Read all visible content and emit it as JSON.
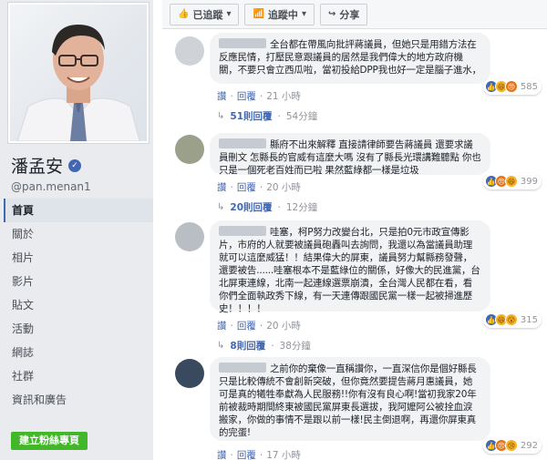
{
  "sidebar": {
    "name": "潘孟安",
    "username": "@pan.menan1",
    "nav": [
      "首頁",
      "關於",
      "相片",
      "影片",
      "貼文",
      "活動",
      "網誌",
      "社群",
      "資訊和廣告"
    ],
    "create_button": "建立粉絲專頁"
  },
  "action_bar": {
    "following": "已追蹤",
    "followed": "追蹤中",
    "share": "分享"
  },
  "comments": [
    {
      "text": "全台都在帶風向批評蔣議員，但她只是用錯方法在反應民情，打壓民意跟議員的居然是我們偉大的地方政府機關，不要只會立西瓜啦，當初投給DPP我也好一定是腦子進水，",
      "reply_label": "讚",
      "reply": "回覆",
      "time": "21 小時",
      "reaction_count": "585",
      "replies_label": "51則回覆",
      "replies_time": "54分鐘"
    },
    {
      "text": "縣府不出來解釋 直接請律師要告蔣議員 還要求議員刪文 怎縣長的官威有這麼大嗎 沒有了縣長光環講難聽點 你也只是一個死老百姓而已啦 果然藍綠都一樣是垃圾",
      "reply_label": "讚",
      "reply": "回覆",
      "time": "20 小時",
      "reaction_count": "399",
      "replies_label": "20則回覆",
      "replies_time": "12分鐘"
    },
    {
      "text": "哇塞，柯P努力改變台北，只是拍0元市政宣傳影片，市府的人就要被議員砲轟叫去詢問，我還以為當議員助理就可以這麼威猛！！結果偉大的屏東，議員努力幫縣務發聲，還要被告......哇塞根本不是藍綠位的關係，好像大的民進黨，台北屏東連線，北南一起連線選票崩潰，全台灣人民都在看，看你們全面執政秀下線，有一天連傳跟國民黨一樣一起被掃進歷史！！！！",
      "reply_label": "讚",
      "reply": "回覆",
      "time": "20 小時",
      "reaction_count": "315",
      "replies_label": "8則回覆",
      "replies_time": "38分鐘"
    },
    {
      "text": "之前你的棄像一直稱讚你，一直深信你是個好縣長只是比較傳統不會創新突破，但你竟然要提告蔣月惠議員，她可是真的犧牲奉獻為人民服務!!你有沒有良心啊!當初我家20年前被裁時期間終東被國民黨屏東長選拔，我阿嬤阿公被拴血淚搬家，你做的事情不是跟以前一樣!民主倒退啊，再還你屏東真的完蛋!",
      "reply_label": "讚",
      "reply": "回覆",
      "time": "17 小時",
      "reaction_count": "292"
    }
  ]
}
